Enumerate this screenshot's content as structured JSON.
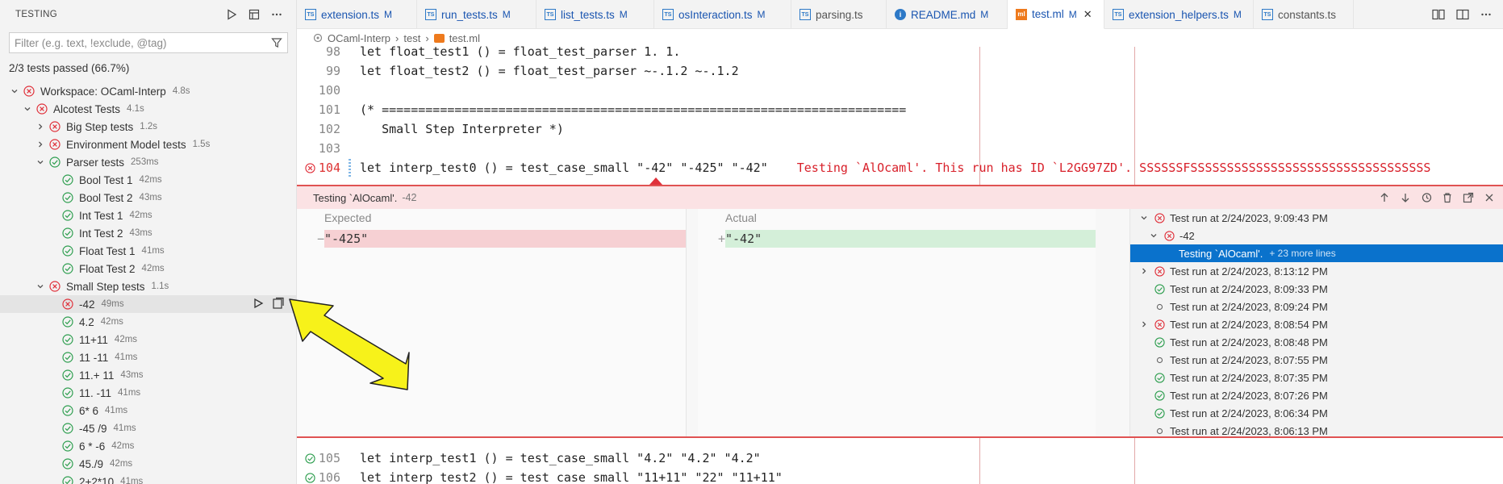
{
  "sidebar": {
    "title": "TESTING",
    "filter_placeholder": "Filter (e.g. text, !exclude, @tag)",
    "summary": "2/3 tests passed (66.7%)",
    "tree": [
      {
        "label": "Workspace: OCaml-Interp",
        "dur": "4.8s",
        "status": "fail",
        "depth": 0,
        "chev": "down"
      },
      {
        "label": "Alcotest Tests",
        "dur": "4.1s",
        "status": "fail",
        "depth": 1,
        "chev": "down"
      },
      {
        "label": "Big Step tests",
        "dur": "1.2s",
        "status": "fail",
        "depth": 2,
        "chev": "right"
      },
      {
        "label": "Environment Model tests",
        "dur": "1.5s",
        "status": "fail",
        "depth": 2,
        "chev": "right"
      },
      {
        "label": "Parser tests",
        "dur": "253ms",
        "status": "pass",
        "depth": 2,
        "chev": "down"
      },
      {
        "label": "Bool Test 1",
        "dur": "42ms",
        "status": "pass",
        "depth": 3,
        "chev": ""
      },
      {
        "label": "Bool Test 2",
        "dur": "43ms",
        "status": "pass",
        "depth": 3,
        "chev": ""
      },
      {
        "label": "Int Test 1",
        "dur": "42ms",
        "status": "pass",
        "depth": 3,
        "chev": ""
      },
      {
        "label": "Int Test 2",
        "dur": "43ms",
        "status": "pass",
        "depth": 3,
        "chev": ""
      },
      {
        "label": "Float Test 1",
        "dur": "41ms",
        "status": "pass",
        "depth": 3,
        "chev": ""
      },
      {
        "label": "Float Test 2",
        "dur": "42ms",
        "status": "pass",
        "depth": 3,
        "chev": ""
      },
      {
        "label": "Small Step tests",
        "dur": "1.1s",
        "status": "fail",
        "depth": 2,
        "chev": "down"
      },
      {
        "label": "-42",
        "dur": "49ms",
        "status": "fail",
        "depth": 3,
        "chev": "",
        "selected": true
      },
      {
        "label": "4.2",
        "dur": "42ms",
        "status": "pass",
        "depth": 3,
        "chev": ""
      },
      {
        "label": "11+11",
        "dur": "42ms",
        "status": "pass",
        "depth": 3,
        "chev": ""
      },
      {
        "label": "11 -11",
        "dur": "41ms",
        "status": "pass",
        "depth": 3,
        "chev": ""
      },
      {
        "label": "11.+ 11",
        "dur": "43ms",
        "status": "pass",
        "depth": 3,
        "chev": ""
      },
      {
        "label": "11. -11",
        "dur": "41ms",
        "status": "pass",
        "depth": 3,
        "chev": ""
      },
      {
        "label": "6* 6",
        "dur": "41ms",
        "status": "pass",
        "depth": 3,
        "chev": ""
      },
      {
        "label": "-45 /9",
        "dur": "41ms",
        "status": "pass",
        "depth": 3,
        "chev": ""
      },
      {
        "label": "6 * -6",
        "dur": "42ms",
        "status": "pass",
        "depth": 3,
        "chev": ""
      },
      {
        "label": "45./9",
        "dur": "42ms",
        "status": "pass",
        "depth": 3,
        "chev": ""
      },
      {
        "label": "2+2*10",
        "dur": "41ms",
        "status": "pass",
        "depth": 3,
        "chev": ""
      }
    ]
  },
  "tabs": [
    {
      "label": "extension.ts",
      "mod": "M",
      "icon": "ts-icon",
      "kind": "ts"
    },
    {
      "label": "run_tests.ts",
      "mod": "M",
      "icon": "ts-icon",
      "kind": "ts"
    },
    {
      "label": "list_tests.ts",
      "mod": "M",
      "icon": "ts-icon",
      "kind": "ts"
    },
    {
      "label": "osInteraction.ts",
      "mod": "M",
      "icon": "ts-icon",
      "kind": "ts"
    },
    {
      "label": "parsing.ts",
      "mod": "",
      "icon": "ts-icon",
      "kind": "ts"
    },
    {
      "label": "README.md",
      "mod": "M",
      "icon": "info-icon",
      "kind": "md"
    },
    {
      "label": "test.ml",
      "mod": "M",
      "icon": "ocaml-icon",
      "kind": "ml",
      "active": true
    },
    {
      "label": "extension_helpers.ts",
      "mod": "M",
      "icon": "ts-icon",
      "kind": "ts"
    },
    {
      "label": "constants.ts",
      "mod": "",
      "icon": "ts-icon",
      "kind": "ts"
    }
  ],
  "breadcrumb": [
    "OCaml-Interp",
    "test",
    "test.ml"
  ],
  "code_top": [
    {
      "ln": "98",
      "text": "let float_test1 () = float_test_parser 1. 1."
    },
    {
      "ln": "99",
      "text": "let float_test2 () = float_test_parser ~-.1.2 ~-.1.2"
    },
    {
      "ln": "100",
      "text": ""
    },
    {
      "ln": "101",
      "text": "(* ========================================================================"
    },
    {
      "ln": "102",
      "text": "   Small Step Interpreter *)"
    },
    {
      "ln": "103",
      "text": ""
    }
  ],
  "error_line": {
    "ln": "104",
    "text": "let interp_test0 () = test_case_small \"-42\" \"-425\" \"-42\"",
    "message": "Testing `AlOcaml'. This run has ID `L2GG97ZD'. SSSSSSFSSSSSSSSSSSSSSSSSSSSSSSSSSSSSSSSS"
  },
  "peek": {
    "title": "Testing `AlOcaml'.",
    "subtitle": "-42",
    "expected_label": "Expected",
    "actual_label": "Actual",
    "expected_value": "\"-425\"",
    "actual_value": "\"-42\"",
    "expected_marker": "−",
    "actual_marker": "+",
    "history": [
      {
        "label": "Test run at 2/24/2023, 9:09:43 PM",
        "status": "fail",
        "chev": "down",
        "depth": 0
      },
      {
        "label": "-42",
        "status": "fail",
        "chev": "down",
        "depth": 1
      },
      {
        "label": "Testing `AlOcaml'.",
        "more": "+ 23 more lines",
        "status": "",
        "chev": "",
        "depth": 2,
        "selected": true
      },
      {
        "label": "Test run at 2/24/2023, 8:13:12 PM",
        "status": "fail",
        "chev": "right",
        "depth": 0
      },
      {
        "label": "Test run at 2/24/2023, 8:09:33 PM",
        "status": "pass",
        "chev": "",
        "depth": 0
      },
      {
        "label": "Test run at 2/24/2023, 8:09:24 PM",
        "status": "none",
        "chev": "",
        "depth": 0
      },
      {
        "label": "Test run at 2/24/2023, 8:08:54 PM",
        "status": "fail",
        "chev": "right",
        "depth": 0
      },
      {
        "label": "Test run at 2/24/2023, 8:08:48 PM",
        "status": "pass",
        "chev": "",
        "depth": 0
      },
      {
        "label": "Test run at 2/24/2023, 8:07:55 PM",
        "status": "none",
        "chev": "",
        "depth": 0
      },
      {
        "label": "Test run at 2/24/2023, 8:07:35 PM",
        "status": "pass",
        "chev": "",
        "depth": 0
      },
      {
        "label": "Test run at 2/24/2023, 8:07:26 PM",
        "status": "pass",
        "chev": "",
        "depth": 0
      },
      {
        "label": "Test run at 2/24/2023, 8:06:34 PM",
        "status": "pass",
        "chev": "",
        "depth": 0
      },
      {
        "label": "Test run at 2/24/2023, 8:06:13 PM",
        "status": "none",
        "chev": "",
        "depth": 0
      }
    ]
  },
  "code_bottom": [
    {
      "ln": "105",
      "text": "let interp_test1 () = test_case_small \"4.2\" \"4.2\" \"4.2\""
    },
    {
      "ln": "106",
      "text": "let interp_test2 () = test_case_small \"11+11\" \"22\" \"11+11\""
    }
  ],
  "colors": {
    "fail": "#e0313b",
    "pass": "#2e9e4f",
    "accent": "#0a72cc",
    "annotation_arrow": "#f7f21a"
  }
}
